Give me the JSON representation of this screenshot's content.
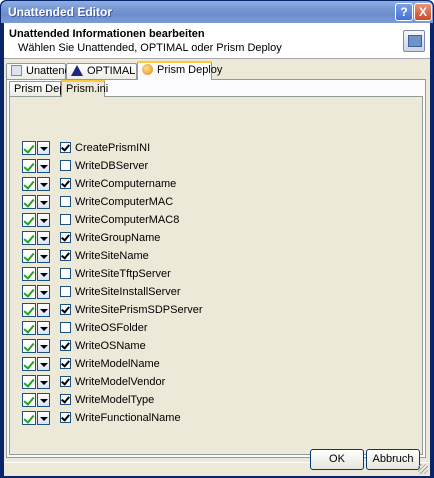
{
  "window": {
    "title": "Unattended Editor",
    "help_glyph": "?",
    "close_glyph": "X"
  },
  "header": {
    "title": "Unattended Informationen bearbeiten",
    "subtitle": "Wählen Sie Unattended, OPTIMAL oder Prism Deploy"
  },
  "tabs": [
    {
      "label": "Unattended",
      "icon": "unattended-icon"
    },
    {
      "label": "OPTIMAL",
      "icon": "optimal-triangle-icon"
    },
    {
      "label": "Prism Deploy",
      "icon": "prism-icon",
      "active": true
    }
  ],
  "subtabs": [
    {
      "label": "Prism Deploy"
    },
    {
      "label": "Prism.ini",
      "active": true
    }
  ],
  "items": [
    {
      "name": "CreatePrismINI",
      "checked": true
    },
    {
      "name": "WriteDBServer",
      "checked": false
    },
    {
      "name": "WriteComputername",
      "checked": true
    },
    {
      "name": "WriteComputerMAC",
      "checked": false
    },
    {
      "name": "WriteComputerMAC8",
      "checked": false
    },
    {
      "name": "WriteGroupName",
      "checked": true
    },
    {
      "name": "WriteSiteName",
      "checked": true
    },
    {
      "name": "WriteSiteTftpServer",
      "checked": false
    },
    {
      "name": "WriteSiteInstallServer",
      "checked": false
    },
    {
      "name": "WriteSitePrismSDPServer",
      "checked": true
    },
    {
      "name": "WriteOSFolder",
      "checked": false
    },
    {
      "name": "WriteOSName",
      "checked": true
    },
    {
      "name": "WriteModelName",
      "checked": true
    },
    {
      "name": "WriteModelVendor",
      "checked": true
    },
    {
      "name": "WriteModelType",
      "checked": true
    },
    {
      "name": "WriteFunctionalName",
      "checked": true
    }
  ],
  "buttons": {
    "ok": "OK",
    "cancel": "Abbruch"
  }
}
